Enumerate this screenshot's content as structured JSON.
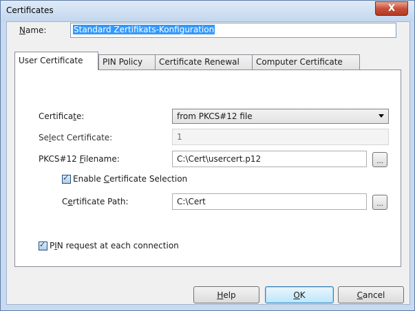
{
  "window": {
    "title": "Certificates",
    "close_label": "X"
  },
  "name": {
    "label_pre": "",
    "label_key": "N",
    "label_post": "ame:",
    "value": "Standard Zertifikats-Konfiguration"
  },
  "tabs": [
    {
      "label": "User Certificate",
      "active": true
    },
    {
      "label": "PIN Policy",
      "active": false
    },
    {
      "label": "Certificate Renewal",
      "active": false
    },
    {
      "label": "Computer Certificate",
      "active": false
    }
  ],
  "user_certificate": {
    "certificate": {
      "label_pre": "Certifica",
      "label_key": "t",
      "label_post": "e:",
      "value": "from PKCS#12 file"
    },
    "select_certificate": {
      "label_pre": "Se",
      "label_key": "l",
      "label_post": "ect Certificate:",
      "value": "1"
    },
    "pkcs12_filename": {
      "label_pre": "PKCS#12 ",
      "label_key": "F",
      "label_post": "ilename:",
      "value": "C:\\Cert\\usercert.p12",
      "browse_label": "..."
    },
    "enable_cert_selection": {
      "label_pre": "Enable ",
      "label_key": "C",
      "label_post": "ertificate Selection",
      "checked": true
    },
    "certificate_path": {
      "label_pre": "C",
      "label_key": "e",
      "label_post": "rtificate Path:",
      "value": "C:\\Cert",
      "browse_label": "..."
    },
    "pin_request": {
      "label_pre": "P",
      "label_key": "I",
      "label_post": "N request at each connection",
      "checked": true
    }
  },
  "buttons": {
    "help": {
      "key": "H",
      "rest": "elp"
    },
    "ok": {
      "key": "O",
      "rest": "K"
    },
    "cancel": {
      "key": "C",
      "rest": "ancel"
    }
  }
}
